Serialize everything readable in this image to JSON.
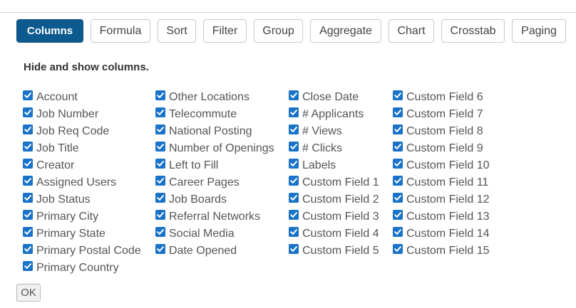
{
  "tabs": [
    {
      "label": "Columns",
      "active": true
    },
    {
      "label": "Formula",
      "active": false
    },
    {
      "label": "Sort",
      "active": false
    },
    {
      "label": "Filter",
      "active": false
    },
    {
      "label": "Group",
      "active": false
    },
    {
      "label": "Aggregate",
      "active": false
    },
    {
      "label": "Chart",
      "active": false
    },
    {
      "label": "Crosstab",
      "active": false
    },
    {
      "label": "Paging",
      "active": false
    }
  ],
  "panel": {
    "heading": "Hide and show columns.",
    "columns": [
      [
        {
          "label": "Account",
          "checked": true
        },
        {
          "label": "Job Number",
          "checked": true
        },
        {
          "label": "Job Req Code",
          "checked": true
        },
        {
          "label": "Job Title",
          "checked": true
        },
        {
          "label": "Creator",
          "checked": true
        },
        {
          "label": "Assigned Users",
          "checked": true
        },
        {
          "label": "Job Status",
          "checked": true
        },
        {
          "label": "Primary City",
          "checked": true
        },
        {
          "label": "Primary State",
          "checked": true
        },
        {
          "label": "Primary Postal Code",
          "checked": true
        },
        {
          "label": "Primary Country",
          "checked": true
        }
      ],
      [
        {
          "label": "Other Locations",
          "checked": true
        },
        {
          "label": "Telecommute",
          "checked": true
        },
        {
          "label": "National Posting",
          "checked": true
        },
        {
          "label": "Number of Openings",
          "checked": true
        },
        {
          "label": "Left to Fill",
          "checked": true
        },
        {
          "label": "Career Pages",
          "checked": true
        },
        {
          "label": "Job Boards",
          "checked": true
        },
        {
          "label": "Referral Networks",
          "checked": true
        },
        {
          "label": "Social Media",
          "checked": true
        },
        {
          "label": "Date Opened",
          "checked": true
        }
      ],
      [
        {
          "label": "Close Date",
          "checked": true
        },
        {
          "label": "# Applicants",
          "checked": true
        },
        {
          "label": "# Views",
          "checked": true
        },
        {
          "label": "# Clicks",
          "checked": true
        },
        {
          "label": "Labels",
          "checked": true
        },
        {
          "label": "Custom Field 1",
          "checked": true
        },
        {
          "label": "Custom Field 2",
          "checked": true
        },
        {
          "label": "Custom Field 3",
          "checked": true
        },
        {
          "label": "Custom Field 4",
          "checked": true
        },
        {
          "label": "Custom Field 5",
          "checked": true
        }
      ],
      [
        {
          "label": "Custom Field 6",
          "checked": true
        },
        {
          "label": "Custom Field 7",
          "checked": true
        },
        {
          "label": "Custom Field 8",
          "checked": true
        },
        {
          "label": "Custom Field 9",
          "checked": true
        },
        {
          "label": "Custom Field 10",
          "checked": true
        },
        {
          "label": "Custom Field 11",
          "checked": true
        },
        {
          "label": "Custom Field 12",
          "checked": true
        },
        {
          "label": "Custom Field 13",
          "checked": true
        },
        {
          "label": "Custom Field 14",
          "checked": true
        },
        {
          "label": "Custom Field 15",
          "checked": true
        }
      ]
    ],
    "ok_label": "OK"
  },
  "colors": {
    "accent": "#0d5a8e",
    "checkbox": "#1a73c8"
  }
}
